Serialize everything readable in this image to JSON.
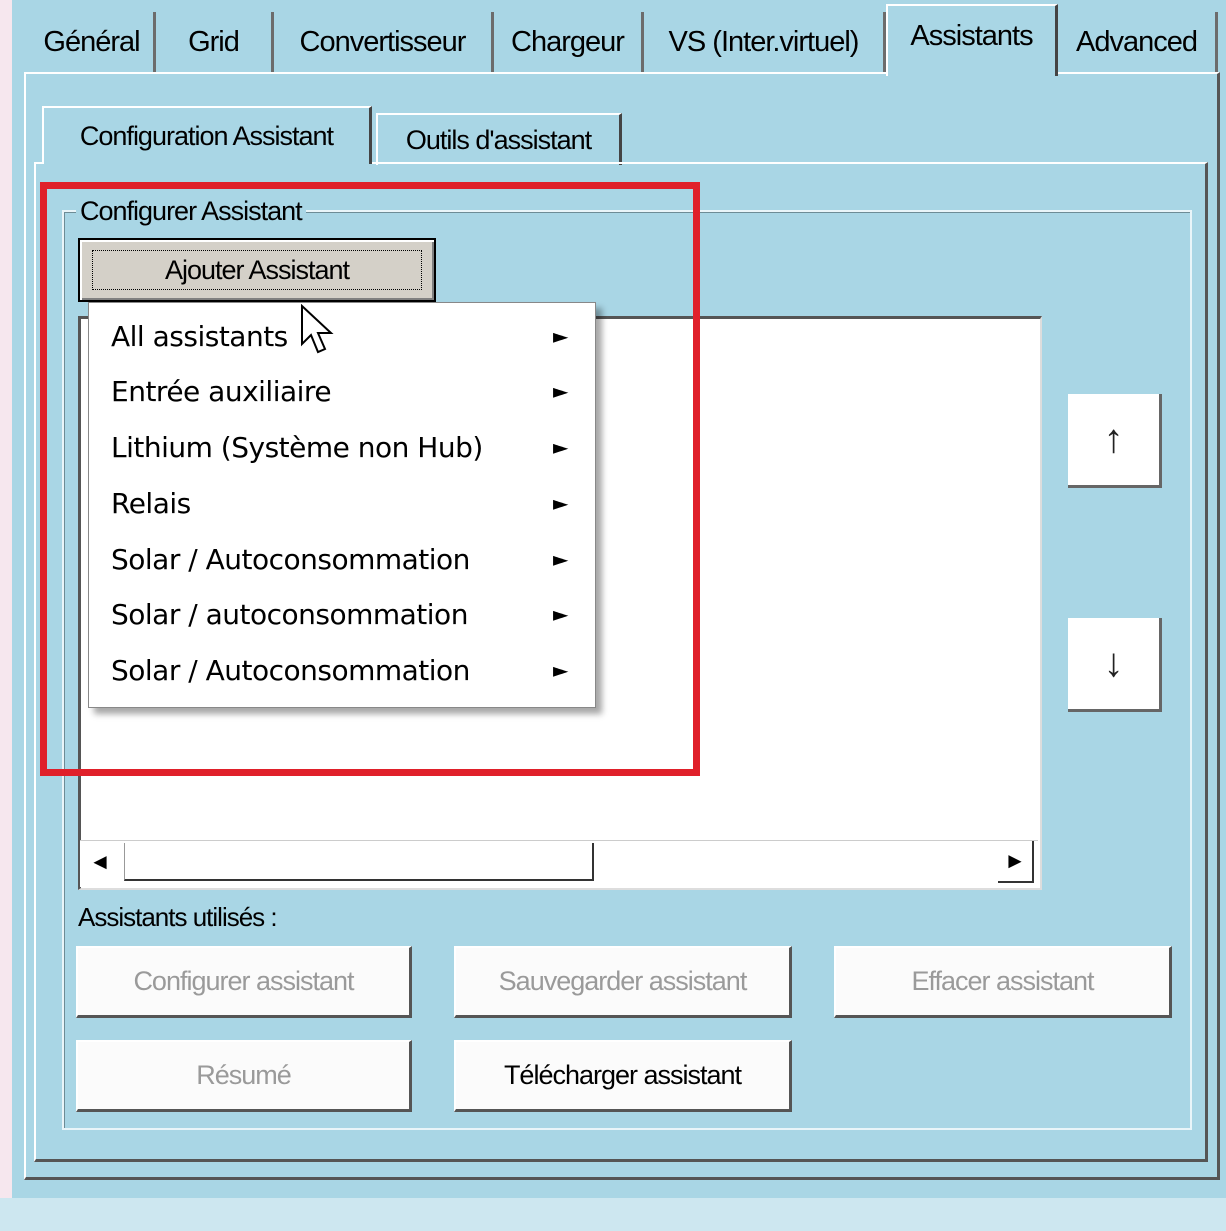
{
  "tabs": [
    "Général",
    "Grid",
    "Convertisseur",
    "Chargeur",
    "VS (Inter.virtuel)",
    "Assistants",
    "Advanced"
  ],
  "active_tab": "Assistants",
  "subtabs": [
    "Configuration Assistant",
    "Outils d'assistant"
  ],
  "group": {
    "legend": "Configurer Assistant",
    "add_button": "Ajouter Assistant"
  },
  "menu": {
    "items": [
      "All assistants",
      "Entrée auxiliaire",
      "Lithium (Système non Hub)",
      "Relais",
      "Solar / Autoconsommation",
      "Solar / autoconsommation",
      "Solar / Autoconsommation"
    ],
    "submenu_icon": "submenu-arrow-icon"
  },
  "icons": {
    "move_up": "↑",
    "move_down": "↓",
    "scroll_left": "◄",
    "scroll_right": "►",
    "submenu": "►"
  },
  "used_label": "Assistants utilisés :",
  "buttons": {
    "configure": "Configurer assistant",
    "save": "Sauvegarder assistant",
    "delete": "Effacer assistant",
    "summary": "Résumé",
    "download": "Télécharger assistant"
  },
  "colors": {
    "background": "#a9d6e5",
    "highlight": "#e0202a"
  }
}
